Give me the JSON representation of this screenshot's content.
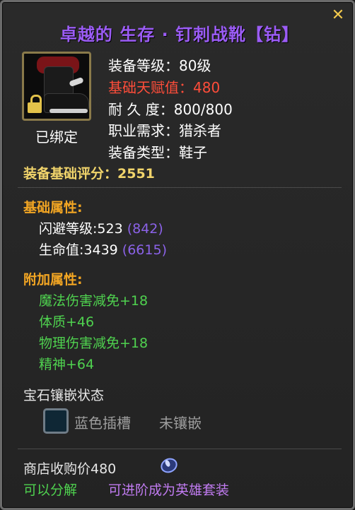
{
  "item": {
    "title": "卓越的 生存 · 钉刺战靴【钻】",
    "bound_label": "已绑定",
    "stats": {
      "item_level": "装备等级：80级",
      "base_talent": "基础天赋值：480",
      "durability": "耐 久 度：800/800",
      "class_req": "职业需求：猎杀者",
      "item_type": "装备类型：鞋子"
    },
    "score": "装备基础评分：2551"
  },
  "base_attributes": {
    "header": "基础属性:",
    "lines": [
      {
        "text": "闪避等级:523 ",
        "paren": "(842)"
      },
      {
        "text": "生命值:3439 ",
        "paren": "(6615)"
      }
    ]
  },
  "extra_attributes": {
    "header": "附加属性:",
    "lines": [
      "魔法伤害减免+18",
      "体质+46",
      "物理伤害减免+18",
      "精神+64"
    ]
  },
  "gems": {
    "header": "宝石镶嵌状态",
    "socket_label": "蓝色插槽",
    "socket_state": "未镶嵌"
  },
  "footer": {
    "shop_price": "商店收购价480",
    "salvage": "可以分解",
    "upgrade": "可进阶成为英雄套装"
  },
  "colors": {
    "title": "#9b5cf5",
    "red_stat": "#ff4d3a",
    "score": "#f1d46b",
    "section": "#f3a623",
    "green": "#4fd24f",
    "paren": "#8b62e8",
    "upgrade": "#c07bf0"
  },
  "icons": {
    "close": "close-icon",
    "item": "spiked-boots-icon",
    "lock": "lock-icon",
    "socket": "blue-gem-socket-icon",
    "currency": "currency-icon"
  }
}
